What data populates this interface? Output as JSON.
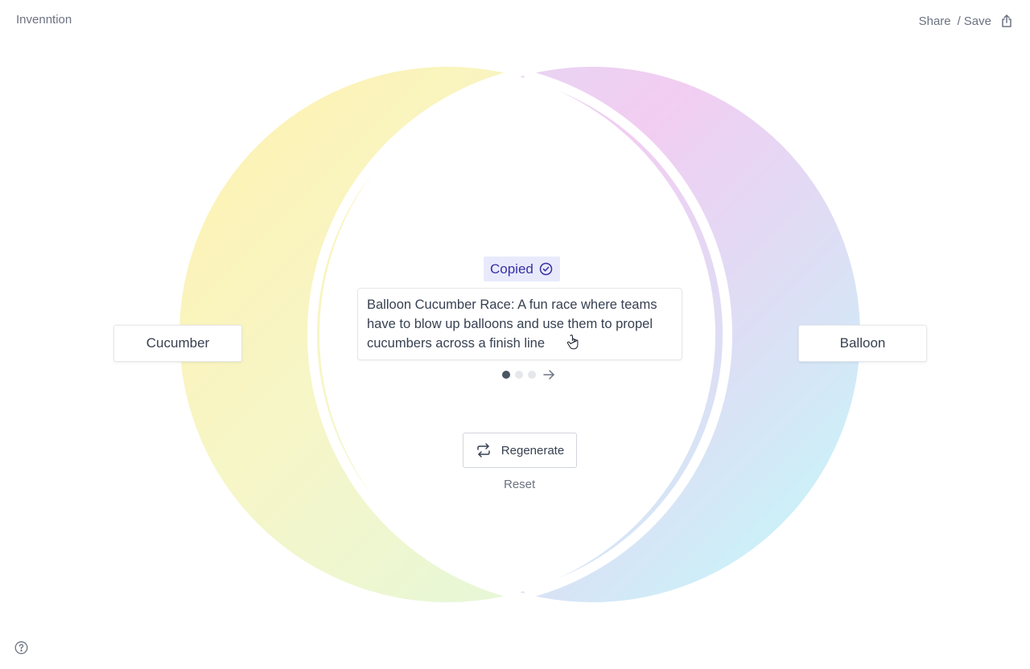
{
  "app": {
    "title": "Invenntion"
  },
  "header": {
    "share_label": "Share",
    "separator": "/",
    "save_label": "Save",
    "share_icon": "share-icon"
  },
  "inputs": {
    "left_item": "Cucumber",
    "right_item": "Balloon"
  },
  "result": {
    "copied_label": "Copied",
    "copied_icon": "check-circle-icon",
    "text": "Balloon Cucumber Race: A fun race where teams have to blow up balloons and use them to propel cucumbers across a finish line",
    "pages_total": 3,
    "current_page": 1
  },
  "actions": {
    "regenerate_label": "Regenerate",
    "reset_label": "Reset"
  },
  "colors": {
    "left_circle": [
      "#fdf1b8",
      "#e4f8dc"
    ],
    "right_circle": [
      "#f4cdf4",
      "#c8f8f8"
    ],
    "copied_bg": "#e8eafc",
    "copied_text": "#3730a3"
  },
  "footer": {
    "help_icon": "help-circle-icon"
  }
}
